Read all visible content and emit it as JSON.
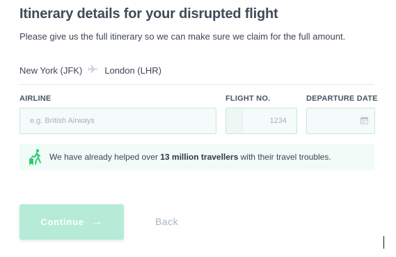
{
  "page": {
    "title": "Itinerary details for your disrupted flight",
    "subtitle": "Please give us the full itinerary so we can make sure we claim for the full amount."
  },
  "route": {
    "origin": "New York (JFK)",
    "destination": "London (LHR)",
    "separator_icon": "plane-icon"
  },
  "form": {
    "airline": {
      "label": "AIRLINE",
      "placeholder": "e.g. British Airways",
      "value": ""
    },
    "flight_no": {
      "label": "FLIGHT NO.",
      "placeholder": "1234",
      "value": ""
    },
    "departure_date": {
      "label": "DEPARTURE DATE",
      "value": "",
      "icon": "calendar-icon"
    }
  },
  "info": {
    "icon": "traveller-with-luggage-icon",
    "text_before": "We have already helped over ",
    "text_bold": "13 million travellers",
    "text_after": " with their travel troubles."
  },
  "actions": {
    "continue_label": "Continue",
    "back_label": "Back"
  },
  "colors": {
    "accent": "#b6ebd8",
    "field_border": "#c6e8dc",
    "info_background": "#f1fbf8",
    "icon_green": "#2ecc71"
  }
}
